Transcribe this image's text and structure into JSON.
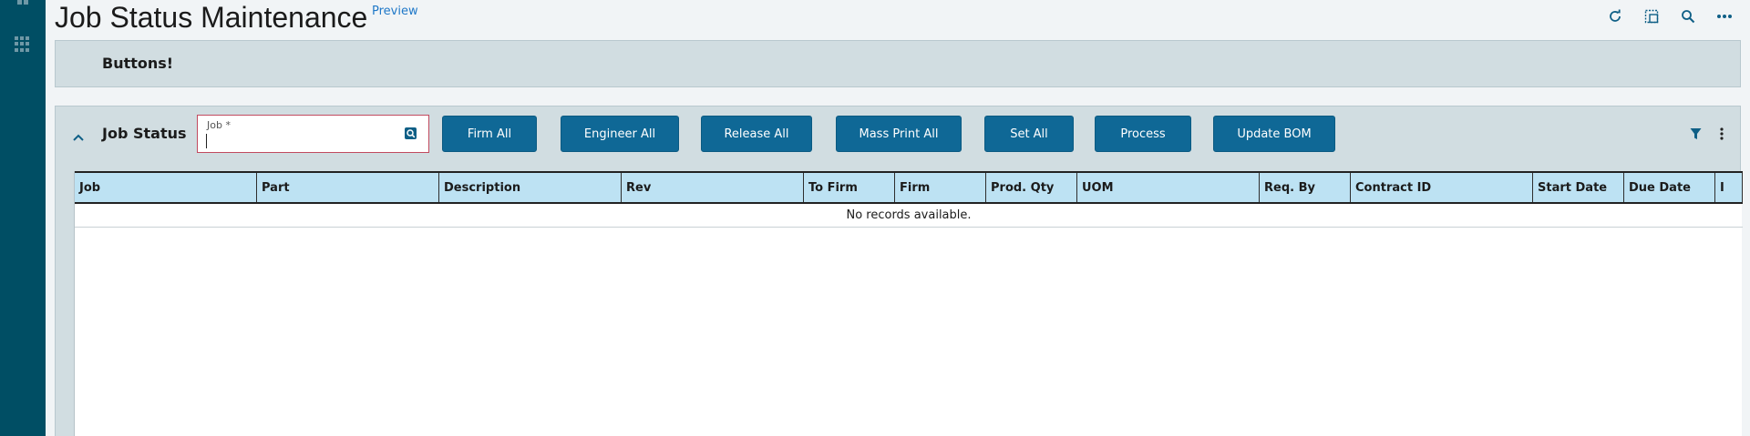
{
  "page": {
    "title": "Job Status Maintenance",
    "preview_label": "Preview"
  },
  "toolbar_icons": [
    "refresh-icon",
    "window-icon",
    "search-icon",
    "more-icon"
  ],
  "buttons_panel": {
    "title": "Buttons!"
  },
  "job_panel": {
    "title": "Job Status",
    "job_field": {
      "label": "Job *",
      "value": ""
    },
    "actions": [
      {
        "label": "Firm All"
      },
      {
        "label": "Engineer All"
      },
      {
        "label": "Release All"
      },
      {
        "label": "Mass Print All"
      },
      {
        "label": "Set All"
      },
      {
        "label": "Process"
      },
      {
        "label": "Update BOM"
      }
    ],
    "grid": {
      "columns": [
        "Job",
        "Part",
        "Description",
        "Rev",
        "To Firm",
        "Firm",
        "Prod. Qty",
        "UOM",
        "Req. By",
        "Contract ID",
        "Start Date",
        "Due Date",
        "I"
      ],
      "empty_message": "No records available."
    }
  },
  "colors": {
    "sidebar": "#004e64",
    "panel": "#d1dde1",
    "button": "#0f6896",
    "header_cell": "#bde2f3",
    "preview_link": "#1f78c8"
  }
}
